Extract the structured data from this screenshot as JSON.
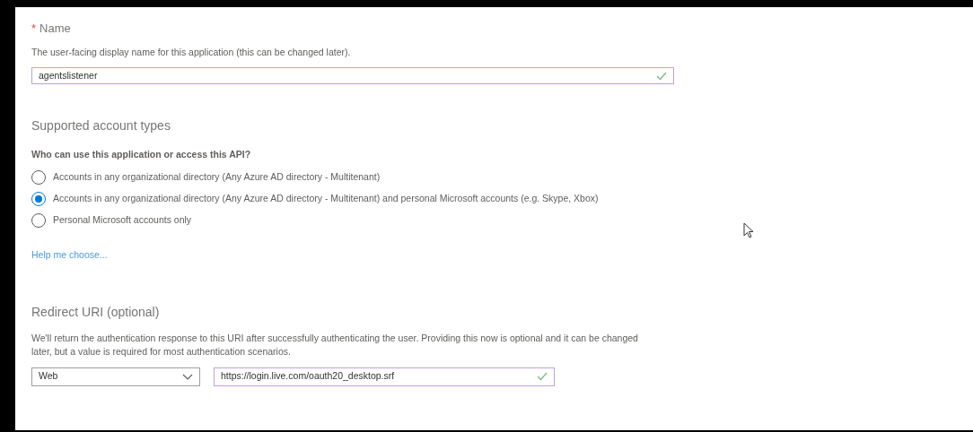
{
  "name_field": {
    "label": "Name",
    "required_mark": "*",
    "description": "The user-facing display name for this application (this can be changed later).",
    "value": "agentslistener",
    "valid": true
  },
  "account_types": {
    "heading": "Supported account types",
    "question": "Who can use this application or access this API?",
    "options": [
      {
        "label": "Accounts in any organizational directory (Any Azure AD directory - Multitenant)",
        "selected": false
      },
      {
        "label": "Accounts in any organizational directory (Any Azure AD directory - Multitenant) and personal Microsoft accounts (e.g. Skype, Xbox)",
        "selected": true
      },
      {
        "label": "Personal Microsoft accounts only",
        "selected": false
      }
    ],
    "help_link": "Help me choose..."
  },
  "redirect_uri": {
    "heading": "Redirect URI (optional)",
    "description": "We'll return the authentication response to this URI after successfully authenticating the user. Providing this now is optional and it can be changed later, but a value is required for most authentication scenarios.",
    "platform": "Web",
    "value": "https://login.live.com/oauth20_desktop.srf",
    "valid": true
  }
}
